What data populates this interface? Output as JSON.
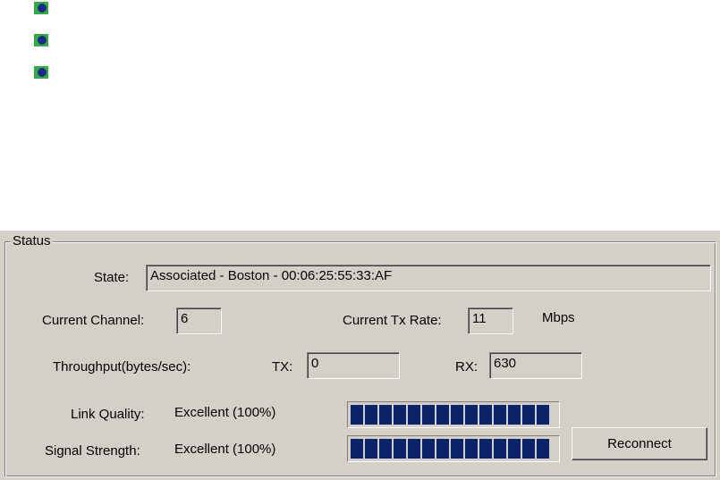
{
  "bullets": [
    {
      "icon": "bullet-icon"
    },
    {
      "icon": "bullet-icon"
    },
    {
      "icon": "bullet-icon"
    }
  ],
  "status": {
    "legend": "Status",
    "state_label": "State:",
    "state_value": "Associated - Boston - 00:06:25:55:33:AF",
    "channel_label": "Current Channel:",
    "channel_value": "6",
    "tx_rate_label": "Current Tx Rate:",
    "tx_rate_value": "11",
    "tx_rate_unit": "Mbps",
    "throughput_label": "Throughput(bytes/sec):",
    "tx_label": "TX:",
    "tx_value": "0",
    "rx_label": "RX:",
    "rx_value": "630",
    "link_quality_label": "Link Quality:",
    "link_quality_value": "Excellent (100%)",
    "link_quality_level": 1.0,
    "signal_strength_label": "Signal Strength:",
    "signal_strength_value": "Excellent (100%)",
    "signal_strength_level": 1.0,
    "reconnect_label": "Reconnect"
  },
  "colors": {
    "panel": "#d4d0c8",
    "meter_fill": "#0a246a"
  }
}
